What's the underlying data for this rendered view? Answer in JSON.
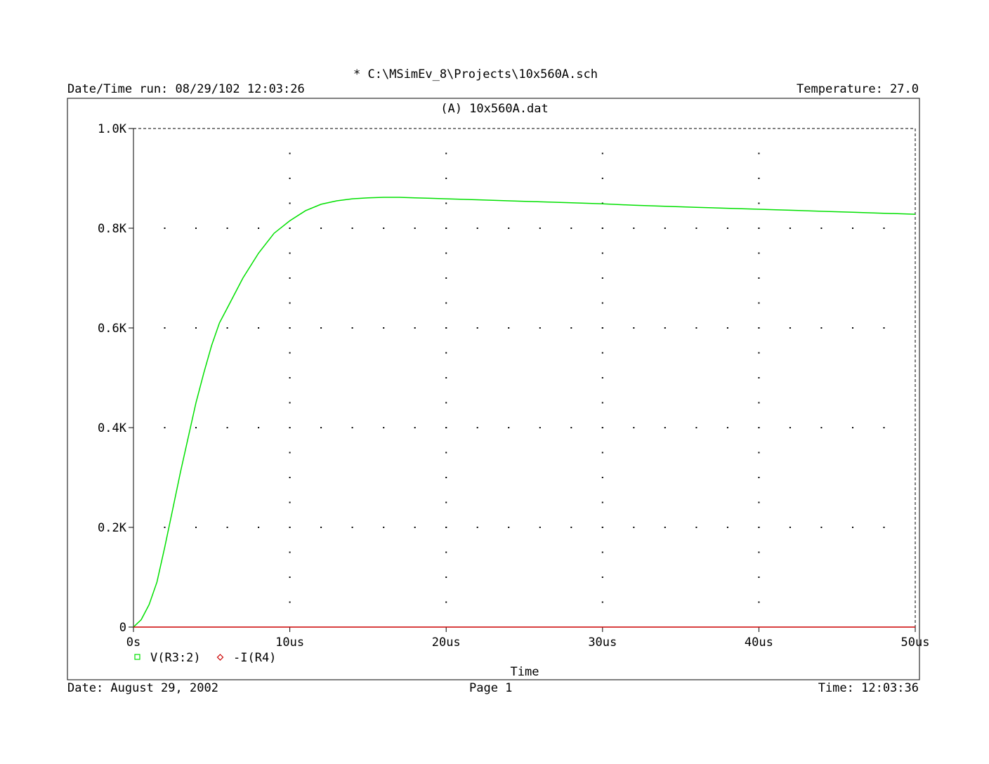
{
  "header": {
    "file_path": "* C:\\MSimEv_8\\Projects\\10x560A.sch",
    "datetime_run": "Date/Time run: 08/29/102 12:03:26",
    "temperature": "Temperature: 27.0"
  },
  "footer": {
    "date": "Date: August 29, 2002",
    "page": "Page 1",
    "time": "Time: 12:03:36"
  },
  "colors": {
    "v_series": "#00e000",
    "i_series": "#cc0000",
    "grid": "#000000"
  },
  "chart_data": {
    "type": "line",
    "title": "(A)  10x560A.dat",
    "xlabel": "Time",
    "ylabel": "",
    "xlim": [
      0,
      50
    ],
    "ylim": [
      0,
      1.0
    ],
    "x_ticks": [
      0,
      10,
      20,
      30,
      40,
      50
    ],
    "x_tick_labels": [
      "0s",
      "10us",
      "20us",
      "30us",
      "40us",
      "50us"
    ],
    "y_ticks": [
      0,
      0.2,
      0.4,
      0.6,
      0.8,
      1.0
    ],
    "y_tick_labels": [
      "0",
      "0.2K",
      "0.4K",
      "0.6K",
      "0.8K",
      "1.0K"
    ],
    "grid": true,
    "legend_position": "bottom-left",
    "series": [
      {
        "name": "V(R3:2)",
        "marker": "square",
        "x": [
          0,
          0.5,
          1,
          1.5,
          2,
          2.5,
          3,
          3.5,
          4,
          4.5,
          5,
          5.5,
          6,
          7,
          8,
          9,
          10,
          11,
          12,
          13,
          14,
          15,
          16,
          17,
          18,
          19,
          20,
          22,
          24,
          26,
          28,
          30,
          32,
          34,
          36,
          38,
          40,
          42,
          44,
          46,
          48,
          50
        ],
        "y": [
          0,
          0.015,
          0.045,
          0.09,
          0.16,
          0.235,
          0.31,
          0.38,
          0.45,
          0.51,
          0.565,
          0.61,
          0.64,
          0.7,
          0.75,
          0.79,
          0.815,
          0.835,
          0.848,
          0.855,
          0.859,
          0.861,
          0.862,
          0.862,
          0.861,
          0.86,
          0.859,
          0.857,
          0.855,
          0.853,
          0.851,
          0.849,
          0.846,
          0.844,
          0.842,
          0.84,
          0.838,
          0.836,
          0.834,
          0.832,
          0.83,
          0.828
        ]
      },
      {
        "name": "-I(R4)",
        "marker": "diamond",
        "x": [
          0,
          50
        ],
        "y": [
          0,
          0
        ]
      }
    ]
  }
}
